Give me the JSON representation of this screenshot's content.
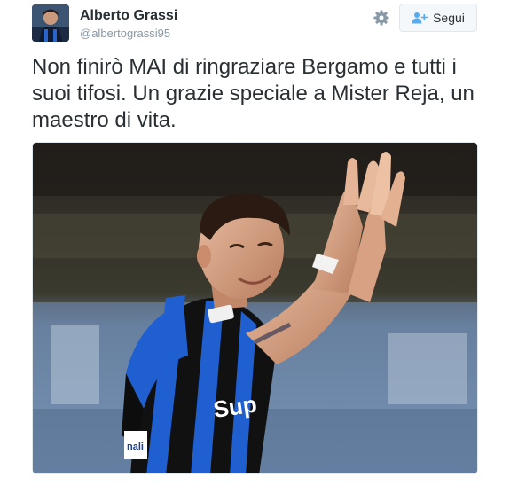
{
  "user": {
    "name": "Alberto Grassi",
    "handle": "@albertograssi95"
  },
  "actions": {
    "settings_icon": "gear-icon",
    "follow_label": "Segui",
    "follow_icon": "add-user-icon"
  },
  "tweet": {
    "text": "Non finirò MAI di ringraziare Bergamo e tutti i suoi tifosi. Un grazie speciale a Mister Reja, un maestro di vita."
  },
  "media": {
    "description_icon": "photo-player-applauding",
    "jersey_text": "Sup",
    "sleeve_text": "nali"
  },
  "colors": {
    "text": "#292f33",
    "secondary": "#8899a6",
    "border": "#e1e8ed",
    "follow_bg": "#f5f8fa",
    "icon_blue": "#55acee",
    "jersey_blue": "#1f5fd0",
    "jersey_black": "#111111"
  }
}
